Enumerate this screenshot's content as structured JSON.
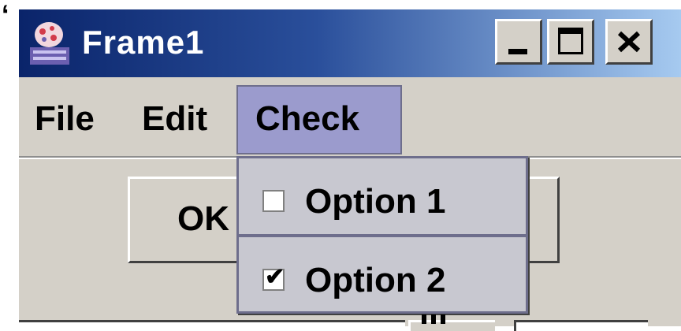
{
  "window": {
    "title": "Frame1",
    "stray_char": "‘"
  },
  "titlebar_buttons": {
    "minimize_icon": "minimize-icon",
    "maximize_icon": "maximize-icon",
    "close_icon": "close-icon"
  },
  "menubar": {
    "items": [
      {
        "label": "File"
      },
      {
        "label": "Edit"
      },
      {
        "label": "Check"
      }
    ]
  },
  "main": {
    "ok_label": "OK"
  },
  "check_menu": {
    "items": [
      {
        "label": "Option 1",
        "checked": false
      },
      {
        "label": "Option 2",
        "checked": true
      }
    ],
    "check_glyph": "✔"
  },
  "colors": {
    "title_gradient_start": "#0a246a",
    "title_gradient_end": "#a6caf0",
    "menu_highlight": "#9b9bcd",
    "window_face": "#d4d0c8"
  }
}
